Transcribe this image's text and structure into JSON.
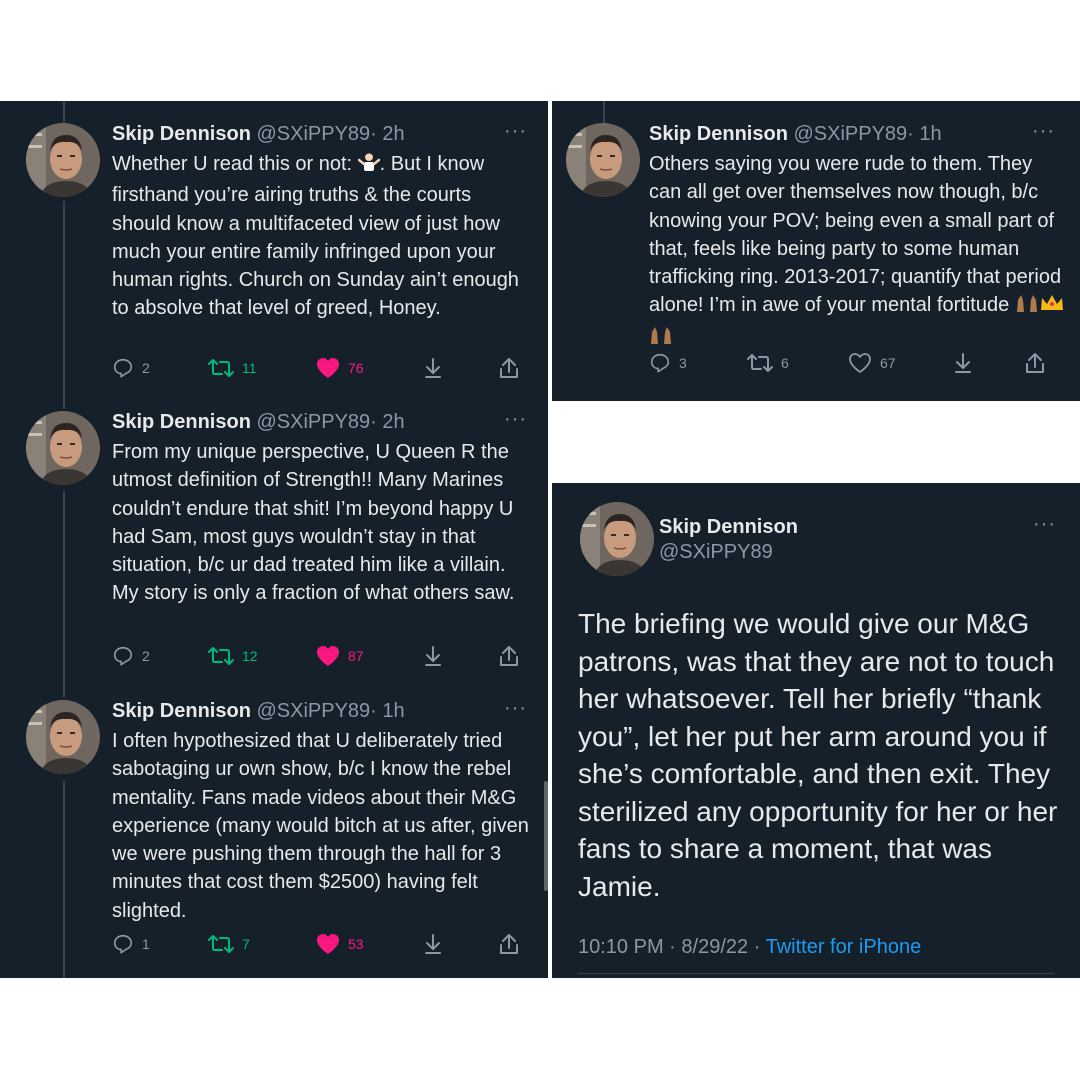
{
  "tweets": [
    {
      "name": "Skip Dennison",
      "handle": "@SXiPPY89",
      "time": "· 2h",
      "text_before_emoji": "Whether U read this or not: ",
      "text_after_emoji": ". But I know firsthand you’re airing truths & the courts should know a multifaceted view of just how much your entire family infringed upon your human rights. Church on Sunday ain’t enough to absolve that level of greed, Honey.",
      "emoji": "person-shrugging-emoji",
      "replies": "2",
      "retweets": "11",
      "likes": "76",
      "liked": true,
      "retweeted": true
    },
    {
      "name": "Skip Dennison",
      "handle": "@SXiPPY89",
      "time": "· 2h",
      "text": "From my unique perspective, U Queen R the utmost definition of Strength!! Many Marines couldn’t endure that shit! I’m beyond happy U had Sam, most guys wouldn’t stay in that situation, b/c ur dad treated him like a villain. My story is only a fraction of what others saw.",
      "replies": "2",
      "retweets": "12",
      "likes": "87",
      "liked": true,
      "retweeted": true
    },
    {
      "name": "Skip Dennison",
      "handle": "@SXiPPY89",
      "time": "· 1h",
      "text": "I often hypothesized that U deliberately tried sabotaging ur own show, b/c I know the rebel mentality. Fans made videos about their M&G experience (many would bitch at us after, given we were pushing them through the hall for 3 minutes that cost them $2500) having felt slighted.",
      "replies": "1",
      "retweets": "7",
      "likes": "53",
      "liked": true,
      "retweeted": true
    },
    {
      "name": "Skip Dennison",
      "handle": "@SXiPPY89",
      "time": "· 1h",
      "text": "Others saying you were rude to them. They can all get over themselves now though, b/c knowing your POV; being even a small part of that, feels like being party to some human trafficking ring. 2013-2017; quantify that period alone! I’m in awe of your mental fortitude",
      "trailing_emoji": [
        "raising-hands-emoji",
        "crown-emoji",
        "raising-hands-emoji"
      ],
      "replies": "3",
      "retweets": "6",
      "likes": "67",
      "liked": false,
      "retweeted": false
    }
  ],
  "focused_tweet": {
    "name": "Skip Dennison",
    "handle": "@SXiPPY89",
    "text": "The briefing we would give our M&G patrons, was that they are not to touch her whatsoever. Tell her briefly “thank you”, let her put her arm around you if she’s comfortable, and then exit. They sterilized any opportunity for her or her fans to share a moment, that was Jamie.",
    "time": "10:10 PM",
    "date": "8/29/22",
    "sep1": "·",
    "sep2": "·",
    "source": "Twitter for iPhone"
  },
  "more_glyph": "···",
  "colors": {
    "panel_bg": "#15202b",
    "text": "#e7e9ea",
    "muted": "#8b98a5",
    "retweet_green": "#00ba7c",
    "like_pink": "#f91880",
    "link_blue": "#1d9bf0"
  }
}
